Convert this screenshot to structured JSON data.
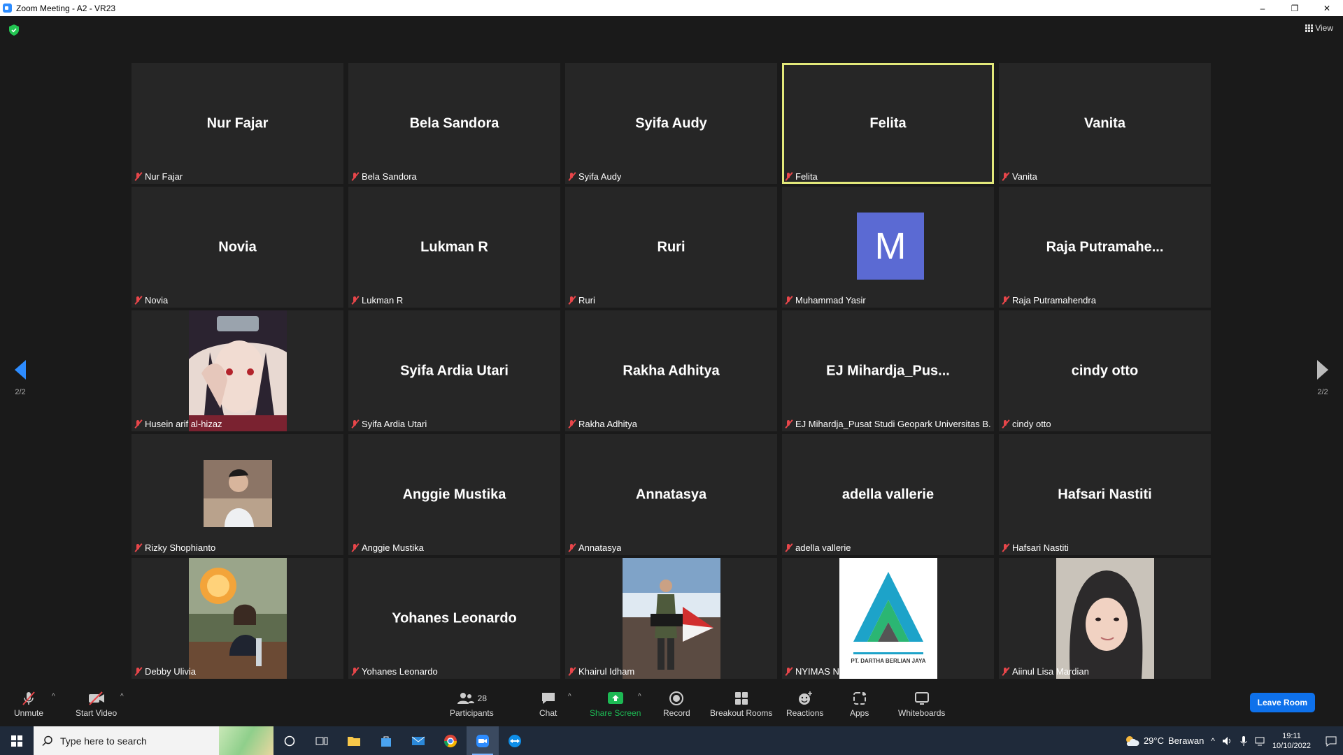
{
  "window": {
    "title": "Zoom Meeting - A2 - VR23",
    "minimize": "–",
    "restore": "❐",
    "close": "✕"
  },
  "meeting": {
    "view_label": "View",
    "page_indicator": "2/2",
    "participants": [
      {
        "display": "Nur Fajar",
        "label": "Nur Fajar",
        "kind": "name"
      },
      {
        "display": "Bela Sandora",
        "label": "Bela Sandora",
        "kind": "name"
      },
      {
        "display": "Syifa Audy",
        "label": "Syifa Audy",
        "kind": "name"
      },
      {
        "display": "Felita",
        "label": "Felita",
        "kind": "name",
        "active": true
      },
      {
        "display": "Vanita",
        "label": "Vanita",
        "kind": "name"
      },
      {
        "display": "Novia",
        "label": "Novia",
        "kind": "name"
      },
      {
        "display": "Lukman R",
        "label": "Lukman R",
        "kind": "name"
      },
      {
        "display": "Ruri",
        "label": "Ruri",
        "kind": "name"
      },
      {
        "display": "M",
        "label": "Muhammad Yasir",
        "kind": "avatar"
      },
      {
        "display": "Raja  Putramahe...",
        "label": "Raja Putramahendra",
        "kind": "name"
      },
      {
        "display": "",
        "label": "Husein arif al-hizaz",
        "kind": "photo",
        "photo": "anime-character"
      },
      {
        "display": "Syifa Ardia Utari",
        "label": "Syifa Ardia Utari",
        "kind": "name"
      },
      {
        "display": "Rakha Adhitya",
        "label": "Rakha Adhitya",
        "kind": "name"
      },
      {
        "display": "EJ  Mihardja_Pus...",
        "label": "EJ Mihardja_Pusat Studi Geopark Universitas B...",
        "kind": "name"
      },
      {
        "display": "cindy otto",
        "label": "cindy otto",
        "kind": "name"
      },
      {
        "display": "",
        "label": "Rizky Shophianto",
        "kind": "photo-small",
        "photo": "person-portrait"
      },
      {
        "display": "Anggie Mustika",
        "label": "Anggie Mustika",
        "kind": "name"
      },
      {
        "display": "Annatasya",
        "label": "Annatasya",
        "kind": "name"
      },
      {
        "display": "adella vallerie",
        "label": "adella vallerie",
        "kind": "name"
      },
      {
        "display": "Hafsari Nastiti",
        "label": "Hafsari Nastiti",
        "kind": "name"
      },
      {
        "display": "",
        "label": "Debby Ulivia",
        "kind": "photo",
        "photo": "cafe-photo"
      },
      {
        "display": "Yohanes Leonardo",
        "label": "Yohanes Leonardo",
        "kind": "name"
      },
      {
        "display": "",
        "label": "Khairul Idham",
        "kind": "photo",
        "photo": "mountain-photo"
      },
      {
        "display": "",
        "label": "NYIMAS NOFRIAL DANIRA RIAN",
        "kind": "photo",
        "photo": "company-logo",
        "logo_text": "PT. DARTHA BERLIAN JAYA"
      },
      {
        "display": "",
        "label": "Aiinul Lisa Mardian",
        "kind": "photo",
        "photo": "webcam-person"
      }
    ]
  },
  "toolbar": {
    "unmute": "Unmute",
    "start_video": "Start Video",
    "participants": "Participants",
    "participants_count": "28",
    "chat": "Chat",
    "share_screen": "Share Screen",
    "record": "Record",
    "breakout_rooms": "Breakout Rooms",
    "reactions": "Reactions",
    "apps": "Apps",
    "whiteboards": "Whiteboards",
    "leave_room": "Leave Room"
  },
  "taskbar": {
    "search_placeholder": "Type here to search",
    "weather_temp": "29°C",
    "weather_desc": "Berawan",
    "time": "19:11",
    "date": "10/10/2022"
  },
  "colors": {
    "accent": "#2d8cff",
    "active_speaker": "#e2e87a",
    "muted": "#e8464a",
    "share_green": "#1db954",
    "leave": "#0e71eb"
  }
}
